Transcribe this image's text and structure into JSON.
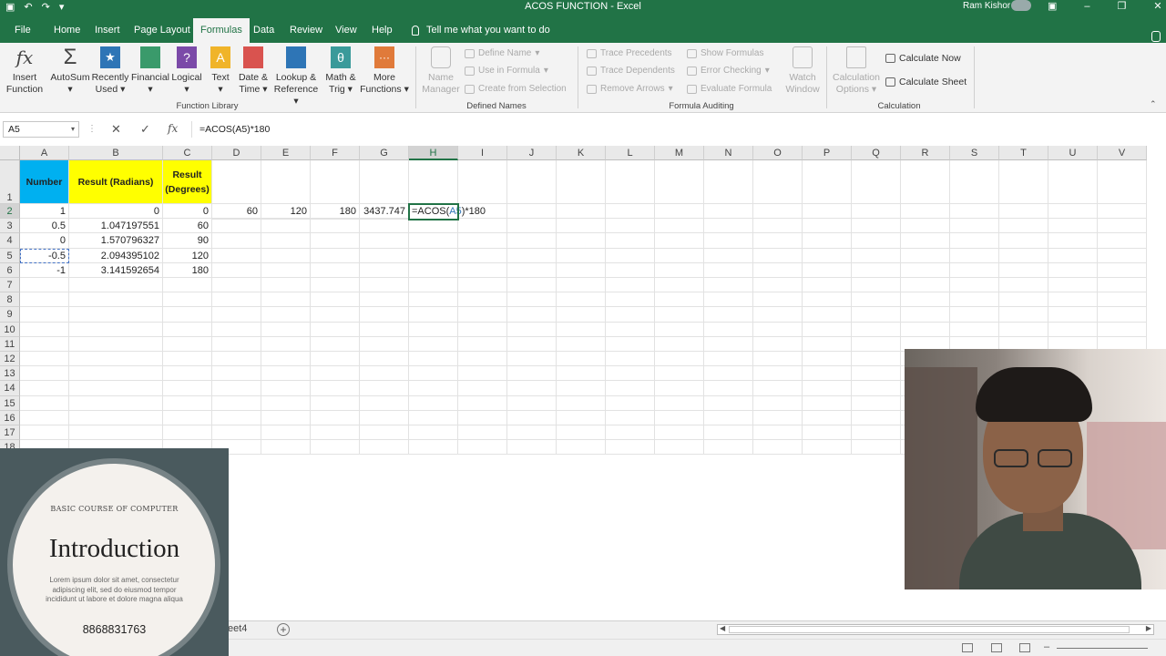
{
  "window": {
    "title": "ACOS FUNCTION  -  Excel",
    "user": "Ram Kishor"
  },
  "tabs": [
    "File",
    "Home",
    "Insert",
    "Page Layout",
    "Formulas",
    "Data",
    "Review",
    "View",
    "Help"
  ],
  "tell_me": "Tell me what you want to do",
  "ribbon": {
    "function_library": {
      "label": "Function Library",
      "buttons": [
        {
          "l1": "Insert",
          "l2": "Function"
        },
        {
          "l1": "AutoSum",
          "l2": "",
          "dd": true
        },
        {
          "l1": "Recently",
          "l2": "Used"
        },
        {
          "l1": "Financial",
          "l2": ""
        },
        {
          "l1": "Logical",
          "l2": ""
        },
        {
          "l1": "Text",
          "l2": ""
        },
        {
          "l1": "Date &",
          "l2": "Time"
        },
        {
          "l1": "Lookup &",
          "l2": "Reference"
        },
        {
          "l1": "Math &",
          "l2": "Trig"
        },
        {
          "l1": "More",
          "l2": "Functions"
        }
      ]
    },
    "defined_names": {
      "label": "Defined Names",
      "name_manager": {
        "l1": "Name",
        "l2": "Manager"
      },
      "define_name": "Define Name",
      "use_in_formula": "Use in Formula",
      "create_from_selection": "Create from Selection"
    },
    "formula_auditing": {
      "label": "Formula Auditing",
      "trace_precedents": "Trace Precedents",
      "trace_dependents": "Trace Dependents",
      "remove_arrows": "Remove Arrows",
      "show_formulas": "Show Formulas",
      "error_checking": "Error Checking",
      "evaluate_formula": "Evaluate Formula",
      "watch_window": {
        "l1": "Watch",
        "l2": "Window"
      }
    },
    "calculation": {
      "label": "Calculation",
      "options": {
        "l1": "Calculation",
        "l2": "Options"
      },
      "calculate_now": "Calculate Now",
      "calculate_sheet": "Calculate Sheet"
    }
  },
  "formula_bar": {
    "name_box": "A5",
    "formula": "=ACOS(A5)*180"
  },
  "grid": {
    "columns": [
      "A",
      "B",
      "C",
      "D",
      "E",
      "F",
      "G",
      "H",
      "I",
      "J",
      "K",
      "L",
      "M",
      "N",
      "O",
      "P",
      "Q",
      "R",
      "S",
      "T",
      "U",
      "V"
    ],
    "rows": [
      "1",
      "2",
      "3",
      "4",
      "5",
      "6",
      "7",
      "8",
      "9",
      "10",
      "11",
      "12",
      "13",
      "14",
      "15",
      "16",
      "17",
      "18"
    ],
    "headers": {
      "a1": "Number",
      "b1": "Result (Radians)",
      "c1": "Result (Degrees)"
    },
    "data": [
      {
        "a": "1",
        "b": "0",
        "c": "0"
      },
      {
        "a": "0.5",
        "b": "1.047197551",
        "c": "60"
      },
      {
        "a": "0",
        "b": "1.570796327",
        "c": "90"
      },
      {
        "a": "-0.5",
        "b": "2.094395102",
        "c": "120"
      },
      {
        "a": "-1",
        "b": "3.141592654",
        "c": "180"
      }
    ],
    "row2_extra": {
      "d": "60",
      "e": "120",
      "f": "180",
      "g": "3437.747",
      "h_prefix": "=ACOS(",
      "h_ref": "A5",
      "h_suffix": ")*180"
    }
  },
  "sheet_tab": "eet4",
  "promo": {
    "kicker": "BASIC COURSE OF COMPUTER",
    "title": "Introduction",
    "body": "Lorem ipsum dolor sit amet, consectetur adipiscing elit, sed do eiusmod tempor incididunt ut labore et dolore magna aliqua",
    "phone": "8868831763"
  },
  "colors": {
    "excel_green": "#217346",
    "header_blue": "#00b0f0",
    "header_yellow": "#ffff00"
  }
}
